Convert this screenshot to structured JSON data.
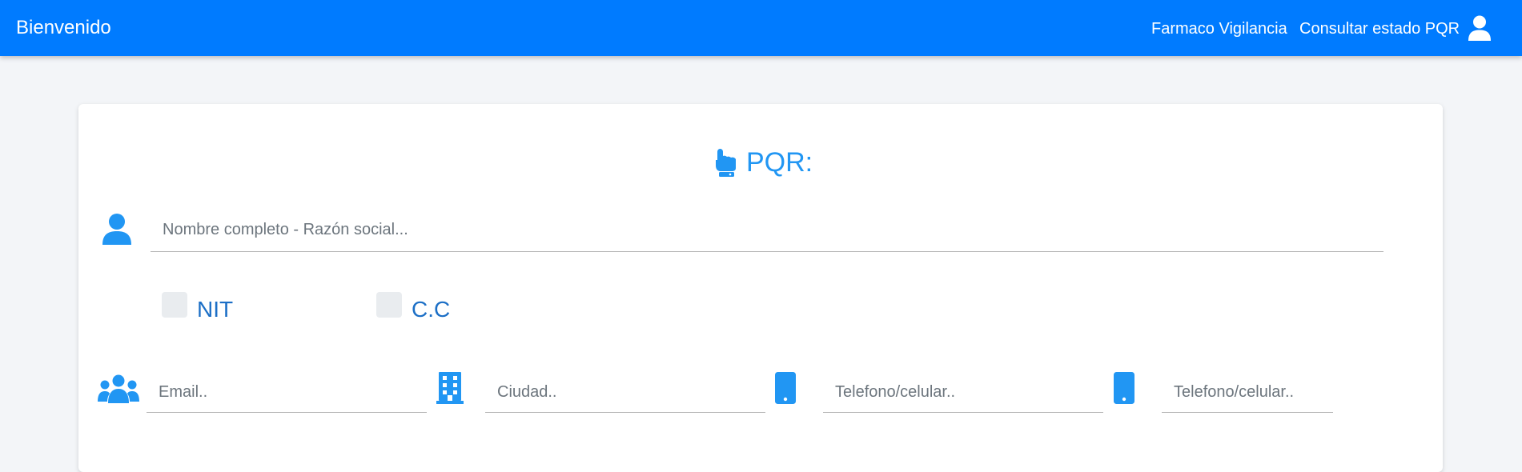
{
  "navbar": {
    "brand": "Bienvenido",
    "links": [
      {
        "label": "Farmaco Vigilancia",
        "icon": "none"
      },
      {
        "label": "Consultar estado PQR",
        "icon": "none"
      }
    ],
    "user_icon": "user-icon"
  },
  "colors": {
    "primary": "#007bff",
    "accent": "#2196f3",
    "label": "#1c6fc6",
    "page_bg": "#f3f5f8"
  },
  "form": {
    "title": "PQR:",
    "title_icon": "hand-pointer-icon",
    "name_field": {
      "placeholder": "Nombre completo - Razón social...",
      "value": "",
      "icon": "user-icon"
    },
    "id_type": {
      "options": [
        {
          "label": "NIT",
          "checked": false
        },
        {
          "label": "C.C",
          "checked": false
        }
      ]
    },
    "email_field": {
      "placeholder": "Email..",
      "value": "",
      "icon": "users-icon"
    },
    "city_field": {
      "placeholder": "Ciudad..",
      "value": "",
      "icon": "building-icon"
    },
    "phone_field_1": {
      "placeholder": "Telefono/celular..",
      "value": "",
      "icon": "mobile-icon"
    },
    "phone_field_2": {
      "placeholder": "Telefono/celular..",
      "value": "",
      "icon": "mobile-icon"
    }
  }
}
